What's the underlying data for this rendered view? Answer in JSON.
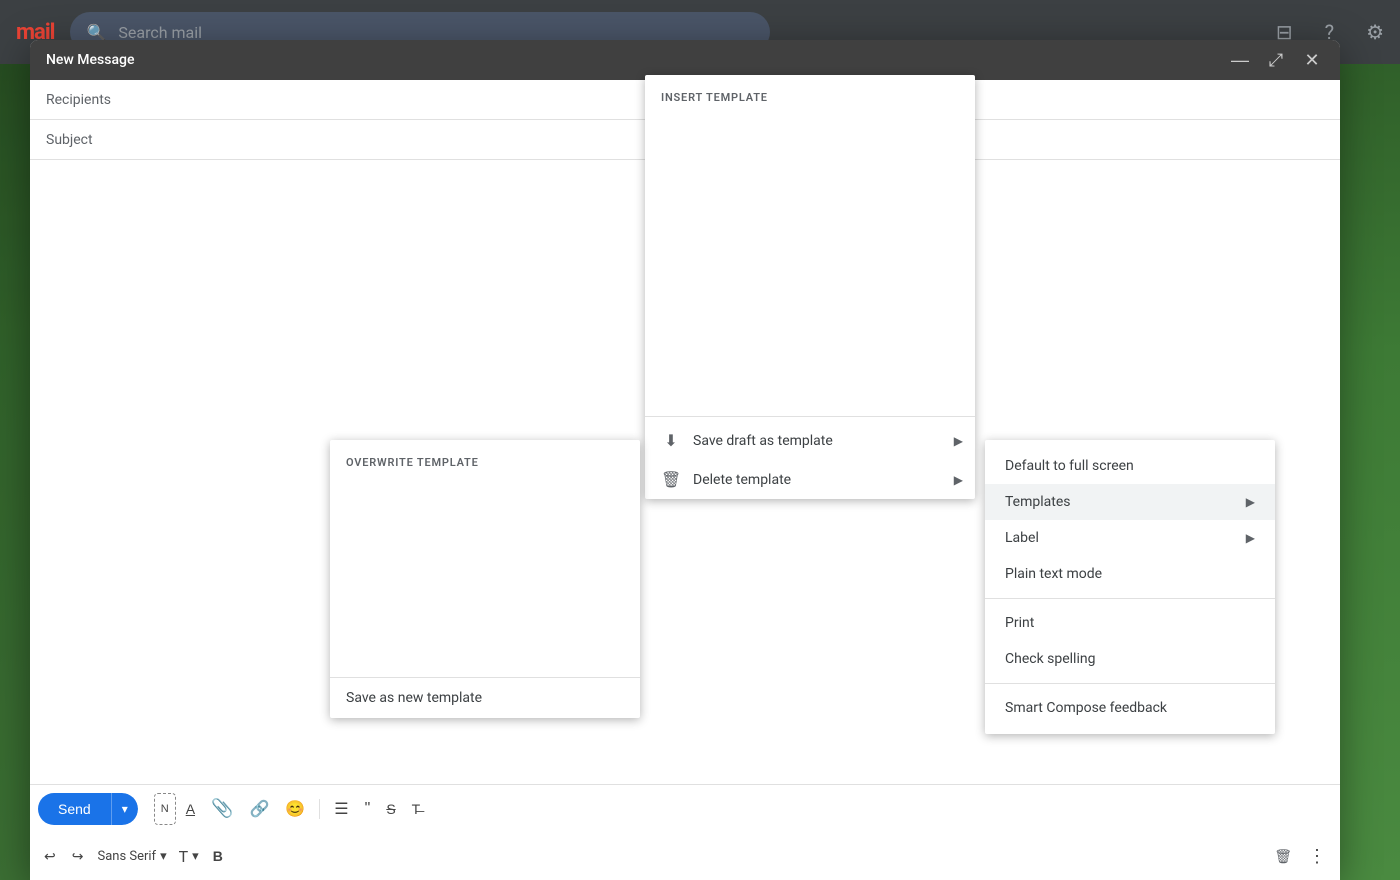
{
  "gmail": {
    "logo": "mail",
    "search_placeholder": "Search mail"
  },
  "compose": {
    "title": "New Message",
    "minimize_label": "—",
    "maximize_label": "⤢",
    "close_label": "✕",
    "recipients_label": "Recipients",
    "subject_label": "Subject",
    "send_button": "Send",
    "font_family": "Sans Serif",
    "toolbar": {
      "undo": "↩",
      "redo": "↪",
      "font": "Sans Serif",
      "font_size": "T",
      "bold": "B",
      "more_options_label": "⋮",
      "delete_label": "🗑"
    }
  },
  "template_panel": {
    "header": "INSERT TEMPLATE",
    "save_draft_label": "Save draft as template",
    "delete_template_label": "Delete template",
    "arrow": "▶"
  },
  "overwrite_panel": {
    "header": "OVERWRITE TEMPLATE",
    "save_new_label": "Save as new template"
  },
  "more_options_menu": {
    "items": [
      {
        "label": "Default to full screen",
        "has_arrow": false
      },
      {
        "label": "Templates",
        "has_arrow": true,
        "highlighted": true
      },
      {
        "label": "Label",
        "has_arrow": true
      },
      {
        "label": "Plain text mode",
        "has_arrow": false
      },
      {
        "label": "Print",
        "has_arrow": false
      },
      {
        "label": "Check spelling",
        "has_arrow": false
      },
      {
        "label": "Smart Compose feedback",
        "has_arrow": false
      }
    ]
  }
}
